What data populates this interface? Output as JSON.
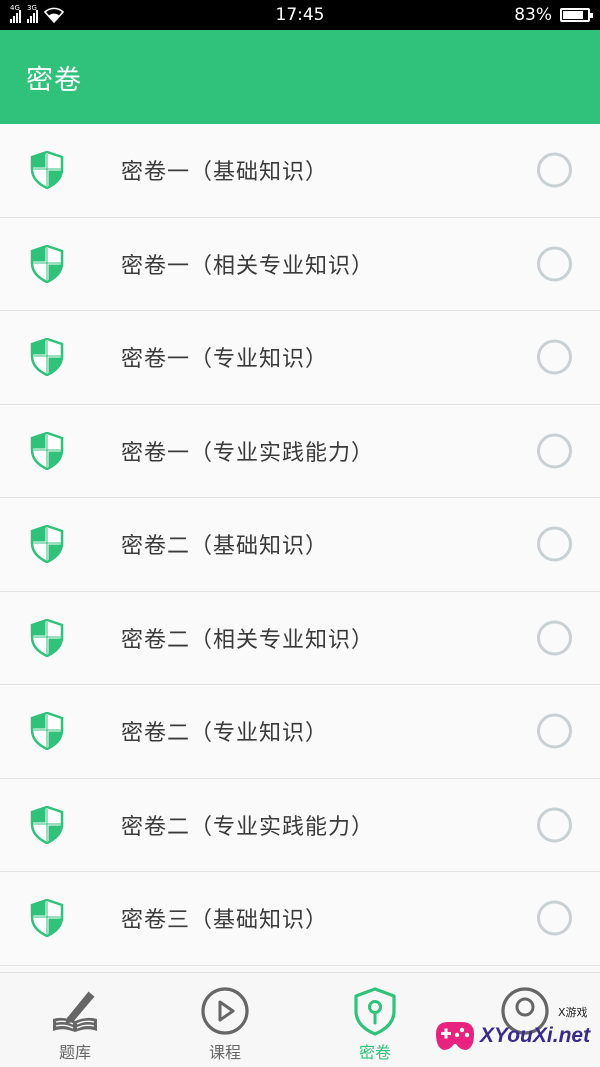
{
  "status_bar": {
    "signal_1_tag": "4G",
    "signal_2_tag": "3G",
    "time": "17:45",
    "battery": "83%",
    "battery_level": 0.83
  },
  "app_bar": {
    "title": "密卷"
  },
  "list": {
    "items": [
      {
        "label": "密卷一（基础知识）",
        "selected": false
      },
      {
        "label": "密卷一（相关专业知识）",
        "selected": false
      },
      {
        "label": "密卷一（专业知识）",
        "selected": false
      },
      {
        "label": "密卷一（专业实践能力）",
        "selected": false
      },
      {
        "label": "密卷二（基础知识）",
        "selected": false
      },
      {
        "label": "密卷二（相关专业知识）",
        "selected": false
      },
      {
        "label": "密卷二（专业知识）",
        "selected": false
      },
      {
        "label": "密卷二（专业实践能力）",
        "selected": false
      },
      {
        "label": "密卷三（基础知识）",
        "selected": false
      }
    ]
  },
  "bottom_nav": {
    "tabs": [
      {
        "label": "题库",
        "icon": "book-pen-icon",
        "active": false
      },
      {
        "label": "课程",
        "icon": "play-circle-icon",
        "active": false
      },
      {
        "label": "密卷",
        "icon": "key-shield-icon",
        "active": true
      },
      {
        "label": "",
        "icon": "user-circle-icon",
        "active": false
      }
    ]
  },
  "watermark": {
    "text": "XYouXi.net",
    "small": "X游戏"
  },
  "colors": {
    "accent": "#30c27b",
    "radio_border": "#c9d0d3",
    "text": "#3a3a3a",
    "nav_inactive": "#666666"
  }
}
